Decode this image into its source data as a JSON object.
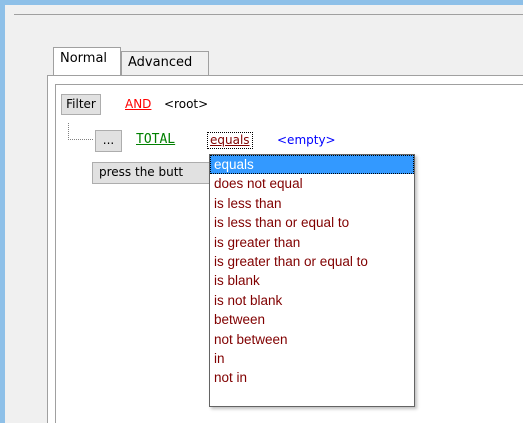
{
  "tabs": [
    {
      "label": "Normal",
      "active": true
    },
    {
      "label": "Advanced",
      "active": false
    }
  ],
  "filter_row": {
    "filter_button": "Filter",
    "operator": "AND",
    "root_label": "<root>"
  },
  "condition_row": {
    "dots_button": "...",
    "field": "TOTAL",
    "comparison": "equals",
    "value": "<empty>"
  },
  "press_button": "press the butt",
  "dropdown": {
    "selected": "equals",
    "options": [
      "equals",
      "does not equal",
      "is less than",
      "is less than or equal to",
      "is greater than",
      "is greater than or equal to",
      "is blank",
      "is not blank",
      "between",
      "not between",
      "in",
      "not in"
    ]
  },
  "colors": {
    "operator": "#ff0000",
    "field": "#008000",
    "comparison": "#800000",
    "value": "#0000ff",
    "selection": "#3399ff"
  }
}
